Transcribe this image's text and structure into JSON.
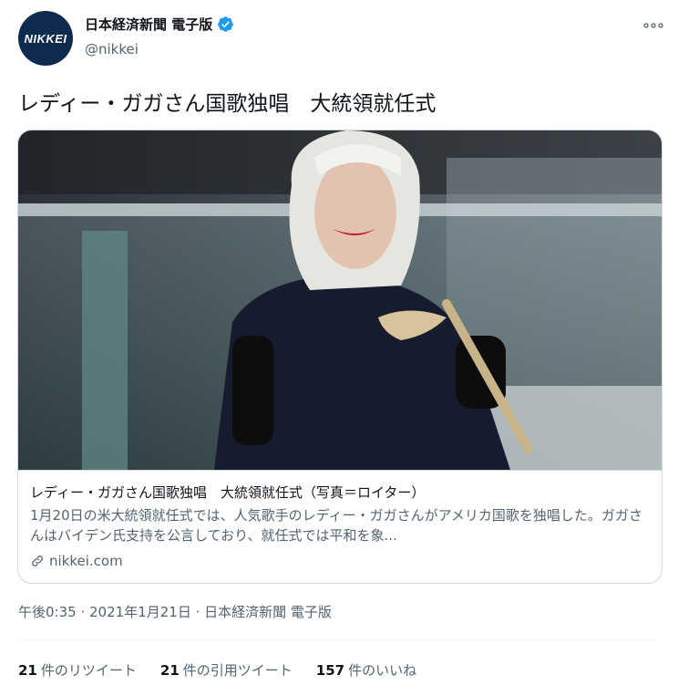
{
  "account": {
    "avatar_text": "NIKKEI",
    "display_name": "日本経済新聞 電子版",
    "handle": "@nikkei",
    "verified": true,
    "avatar_color": "#0d2a4f",
    "verified_color": "#1d9bf0"
  },
  "tweet": {
    "text": "レディー・ガガさん国歌独唱　大統領就任式"
  },
  "card": {
    "title": "レディー・ガガさん国歌独唱　大統領就任式（写真＝ロイター）",
    "description": "1月20日の米大統領就任式では、人気歌手のレディー・ガガさんがアメリカ国歌を独唱した。ガガさんはバイデン氏支持を公言しており、就任式では平和を象...",
    "domain": "nikkei.com",
    "image_description": "photo"
  },
  "meta": {
    "time": "午後0:35",
    "date": "2021年1月21日",
    "source": "日本経済新聞 電子版"
  },
  "stats": {
    "retweets_count": "21",
    "retweets_label": "件のリツイート",
    "quotes_count": "21",
    "quotes_label": "件の引用ツイート",
    "likes_count": "157",
    "likes_label": "件のいいね"
  }
}
